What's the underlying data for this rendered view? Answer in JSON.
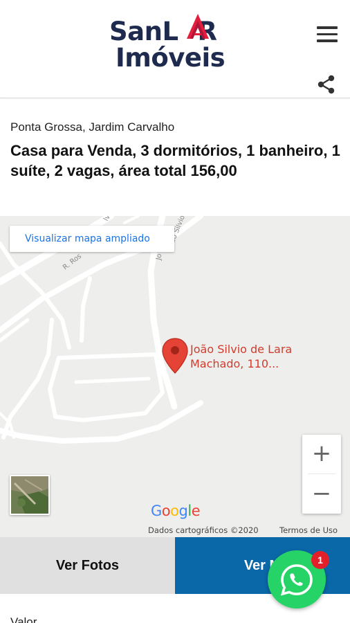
{
  "header": {
    "logo_line1_a": "San",
    "logo_line1_b": "L",
    "logo_line1_c": "R",
    "logo_line2": "Imóveis",
    "menu_icon": "hamburger-menu-icon",
    "share_icon": "share-icon",
    "brand_color": "#1e2a4e",
    "accent_color": "#e31d3c"
  },
  "listing": {
    "location": "Ponta Grossa, Jardim Carvalho",
    "title": "Casa para Venda, 3 dormitórios, 1 banheiro, 1 suíte, 2 vagas, área total 156,00"
  },
  "map": {
    "expand_link": "Visualizar mapa ampliado",
    "street_label_1": "R. Ros",
    "street_label_2": "lva",
    "street_label_3": "João Silvio de",
    "street_label_4": "Jo",
    "pin_label_line1": "João Silvio de Lara",
    "pin_label_line2": "Machado, 110...",
    "zoom_in": "+",
    "zoom_out": "−",
    "google_logo": [
      "G",
      "o",
      "o",
      "g",
      "l",
      "e"
    ],
    "data_credit": "Dados cartográficos ©2020",
    "terms": "Termos de Uso"
  },
  "actions": {
    "photos_button": "Ver Fotos",
    "map_button": "Ver M",
    "map_button_color": "#0a68a8"
  },
  "details": {
    "valor_label": "Valor"
  },
  "whatsapp": {
    "icon": "whatsapp-icon",
    "badge_count": "1",
    "color": "#25d366"
  }
}
